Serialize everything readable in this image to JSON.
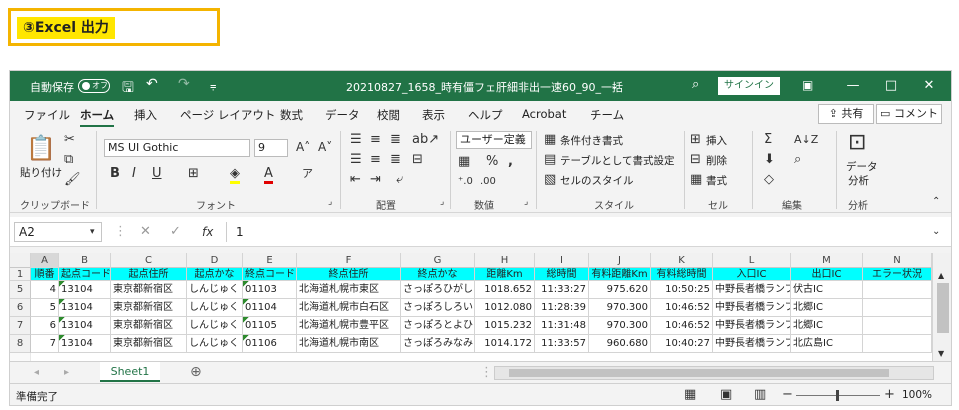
{
  "caption": "③Excel 出力",
  "titlebar": {
    "autosave_label": "自動保存",
    "autosave_state": "オフ",
    "filename": "20210827_1658_時有僵フェ肝細非出一速60_90_一括",
    "signin": "サインイン",
    "minimize": "—",
    "maximize": "□",
    "close": "✕"
  },
  "tabs": [
    "ファイル",
    "ホーム",
    "挿入",
    "ページ レイアウト",
    "数式",
    "データ",
    "校閲",
    "表示",
    "ヘルプ",
    "Acrobat",
    "チーム"
  ],
  "share_label": "共有",
  "comment_label": "コメント",
  "ribbon": {
    "clipboard": {
      "paste": "貼り付け",
      "label": "クリップボード"
    },
    "font": {
      "name": "MS UI Gothic",
      "size": "9",
      "bold": "B",
      "italic": "I",
      "underline": "U",
      "label": "フォント"
    },
    "alignment": {
      "label": "配置"
    },
    "number": {
      "format": "ユーザー定義",
      "label": "数値"
    },
    "styles": {
      "conditional": "条件付き書式",
      "table": "テーブルとして書式設定",
      "cell": "セルのスタイル",
      "label": "スタイル"
    },
    "cells": {
      "insert": "挿入",
      "delete": "削除",
      "format": "書式",
      "label": "セル"
    },
    "editing": {
      "label": "編集"
    },
    "analysis": {
      "btn1": "データ",
      "btn2": "分析",
      "label": "分析"
    }
  },
  "formula_bar": {
    "namebox": "A2",
    "fx": "fx",
    "value": "1"
  },
  "columns": [
    "A",
    "B",
    "C",
    "D",
    "E",
    "F",
    "G",
    "H",
    "I",
    "J",
    "K",
    "L",
    "M",
    "N"
  ],
  "header_row": {
    "row_number": "1",
    "cells": [
      "順番",
      "起点コード",
      "起点住所",
      "起点かな",
      "終点コード",
      "終点住所",
      "終点かな",
      "距離Km",
      "総時間",
      "有料距離Km",
      "有料総時間",
      "入口IC",
      "出口IC",
      "エラー状況"
    ]
  },
  "rows": [
    {
      "row_number": "5",
      "cells": [
        "4",
        "13104",
        "東京都新宿区",
        "しんじゅく",
        "01103",
        "北海道札幌市東区",
        "さっぽろひがし",
        "1018.652",
        "11:33:27",
        "975.620",
        "10:50:25",
        "中野長者橋ランプ",
        "伏古IC",
        ""
      ]
    },
    {
      "row_number": "6",
      "cells": [
        "5",
        "13104",
        "東京都新宿区",
        "しんじゅく",
        "01104",
        "北海道札幌市白石区",
        "さっぽろしろいし",
        "1012.080",
        "11:28:39",
        "970.300",
        "10:46:52",
        "中野長者橋ランプ",
        "北郷IC",
        ""
      ]
    },
    {
      "row_number": "7",
      "cells": [
        "6",
        "13104",
        "東京都新宿区",
        "しんじゅく",
        "01105",
        "北海道札幌市豊平区",
        "さっぽろとよひら",
        "1015.232",
        "11:31:48",
        "970.300",
        "10:46:52",
        "中野長者橋ランプ",
        "北郷IC",
        ""
      ]
    },
    {
      "row_number": "8",
      "cells": [
        "7",
        "13104",
        "東京都新宿区",
        "しんじゅく",
        "01106",
        "北海道札幌市南区",
        "さっぽろみなみ",
        "1014.172",
        "11:33:57",
        "960.680",
        "10:40:27",
        "中野長者橋ランプ",
        "北広島IC",
        ""
      ]
    }
  ],
  "sheet_tab": "Sheet1",
  "add_sheet": "⊕",
  "status": {
    "ready": "準備完了",
    "zoom": "100%"
  }
}
